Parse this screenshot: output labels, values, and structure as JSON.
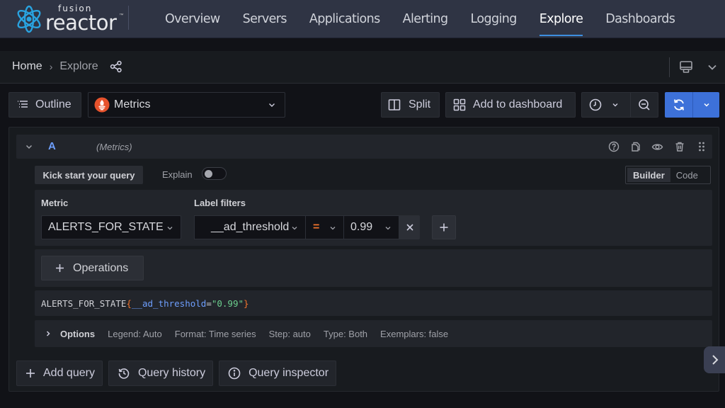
{
  "brand": {
    "line1": "fusion",
    "line2": "reactor",
    "tm": "™"
  },
  "nav": {
    "items": [
      {
        "label": "Overview",
        "active": false
      },
      {
        "label": "Servers",
        "active": false
      },
      {
        "label": "Applications",
        "active": false
      },
      {
        "label": "Alerting",
        "active": false
      },
      {
        "label": "Logging",
        "active": false
      },
      {
        "label": "Explore",
        "active": true
      },
      {
        "label": "Dashboards",
        "active": false
      }
    ]
  },
  "breadcrumb": {
    "home": "Home",
    "separator": "›",
    "current": "Explore"
  },
  "toolbar": {
    "outline_label": "Outline",
    "datasource": "Metrics",
    "split_label": "Split",
    "add_to_dashboard_label": "Add to dashboard"
  },
  "query": {
    "ref_id": "A",
    "datasource_tag": "(Metrics)",
    "kick_start_label": "Kick start your query",
    "explain_label": "Explain",
    "explain_enabled": false,
    "modes": [
      {
        "label": "Builder",
        "active": true
      },
      {
        "label": "Code",
        "active": false
      }
    ],
    "metric_label": "Metric",
    "metric_value": "ALERTS_FOR_STATE",
    "label_filters_label": "Label filters",
    "filter": {
      "label": "__ad_threshold",
      "operator": "=",
      "value": "0.99"
    },
    "operations_label": "Operations",
    "promql": {
      "metric": "ALERTS_FOR_STATE",
      "open": "{",
      "label": "__ad_threshold",
      "eq": "=",
      "value": "\"0.99\"",
      "close": "}"
    },
    "options": {
      "title": "Options",
      "items": [
        "Legend: Auto",
        "Format: Time series",
        "Step: auto",
        "Type: Both",
        "Exemplars: false"
      ]
    }
  },
  "bottom": {
    "add_query_label": "Add query",
    "query_history_label": "Query history",
    "query_inspector_label": "Query inspector"
  },
  "colors": {
    "accent": "#3d71d9",
    "nav_active": "#3d8fe0",
    "ref_id": "#6e9fff",
    "operator": "#f2742c",
    "string": "#6ccf8e",
    "prometheus": "#e6522c"
  }
}
